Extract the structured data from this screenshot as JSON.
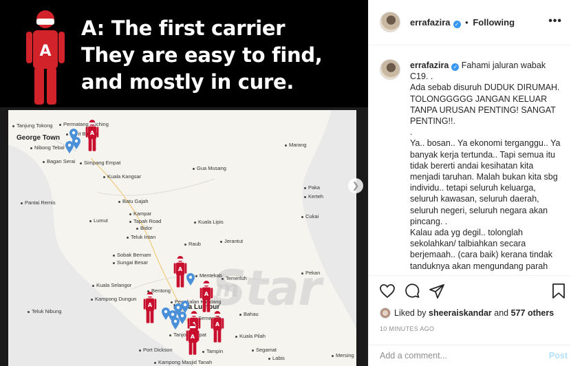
{
  "post_image": {
    "banner": {
      "figure_letter": "A",
      "lines": [
        "A: The first carrier",
        "They are easy to find,",
        "and mostly in cure."
      ]
    },
    "map": {
      "carrier_letter": "A",
      "places": [
        {
          "name": "Tanjung Tokong",
          "size": "small"
        },
        {
          "name": "Permatang Kuching",
          "size": "small"
        },
        {
          "name": "George Town",
          "size": "big"
        },
        {
          "name": "Nibong Tebal",
          "size": "small"
        },
        {
          "name": "Parit Buntar",
          "size": "small"
        },
        {
          "name": "Bagan Serai",
          "size": "small"
        },
        {
          "name": "Simpang Empat",
          "size": "small"
        },
        {
          "name": "Marang",
          "size": "small"
        },
        {
          "name": "Kuala Kangsar",
          "size": "small"
        },
        {
          "name": "Gua Musang",
          "size": "small"
        },
        {
          "name": "Paka",
          "size": "small"
        },
        {
          "name": "Kerteh",
          "size": "small"
        },
        {
          "name": "Pantai Remis",
          "size": "small"
        },
        {
          "name": "Batu Gajah",
          "size": "small"
        },
        {
          "name": "Kampar",
          "size": "small"
        },
        {
          "name": "Tapah Road",
          "size": "small"
        },
        {
          "name": "Lumut",
          "size": "small"
        },
        {
          "name": "Bidor",
          "size": "small"
        },
        {
          "name": "Kuala Lipis",
          "size": "small"
        },
        {
          "name": "Cukai",
          "size": "small"
        },
        {
          "name": "Teluk Intan",
          "size": "small"
        },
        {
          "name": "Jerantut",
          "size": "small"
        },
        {
          "name": "Sobak Bernam",
          "size": "small"
        },
        {
          "name": "Raub",
          "size": "small"
        },
        {
          "name": "Sungai Besar",
          "size": "small"
        },
        {
          "name": "Bentong",
          "size": "small"
        },
        {
          "name": "Mentekab",
          "size": "small"
        },
        {
          "name": "Temerluh",
          "size": "small"
        },
        {
          "name": "Pekan",
          "size": "small"
        },
        {
          "name": "Kuala Selangor",
          "size": "small"
        },
        {
          "name": "Kampong Dungun",
          "size": "small"
        },
        {
          "name": "Pengkalan Kundang",
          "size": "small"
        },
        {
          "name": "Kuala Lumpur",
          "size": "big"
        },
        {
          "name": "Teluk Nibung",
          "size": "small"
        },
        {
          "name": "Semenyih",
          "size": "small"
        },
        {
          "name": "Bahau",
          "size": "small"
        },
        {
          "name": "Kuala Pilah",
          "size": "small"
        },
        {
          "name": "Tanjong Sepat",
          "size": "small"
        },
        {
          "name": "Port Dickson",
          "size": "small"
        },
        {
          "name": "Tampin",
          "size": "small"
        },
        {
          "name": "Segamat",
          "size": "small"
        },
        {
          "name": "Labis",
          "size": "small"
        },
        {
          "name": "Mersing",
          "size": "small"
        },
        {
          "name": "Kampong Masjid Tanah",
          "size": "small"
        }
      ],
      "watermark": "Star",
      "watermark_prefix": "m"
    }
  },
  "sidebar": {
    "header": {
      "username": "errafazira",
      "verified_glyph": "✓",
      "separator": "•",
      "follow_status": "Following",
      "more": "•••"
    },
    "caption": {
      "username": "errafazira",
      "verified_glyph": "✓",
      "text": "Fahami jaluran wabak C19. .\nAda sebab disuruh DUDUK DIRUMAH. TOLONGGGGG JANGAN KELUAR TANPA URUSAN PENTING! SANGAT PENTING!!.\n.\nYa.. bosan.. Ya ekonomi terganggu.. Ya banyak kerja tertunda.. Tapi semua itu tidak bererti andai kesihatan kita menjadi taruhan. Malah bukan kita sbg individu.. tetapi seluruh keluarga, seluruh kawasan, seluruh daerah, seluruh negeri, seluruh negara akan pincang. .\nKalau ada yg degil.. tolonglah sekolahkan/ talbiahkan secara berjemaah.. (cara baik) kerana tindak tanduknya akan mengundang parah"
    },
    "actions": {
      "icons": [
        "heart-icon",
        "comment-icon",
        "share-icon",
        "bookmark-icon"
      ]
    },
    "likes": {
      "prefix": "Liked by",
      "user": "sheeraiskandar",
      "connector": "and",
      "others": "577 others"
    },
    "timestamp": "10 MINUTES AGO",
    "comment_box": {
      "placeholder": "Add a comment...",
      "post_label": "Post"
    },
    "colors": {
      "verified": "#3897f0",
      "post_disabled": "#b2dffc",
      "carrier_red": "#c8102e",
      "pin_blue": "#4a90d9"
    }
  }
}
